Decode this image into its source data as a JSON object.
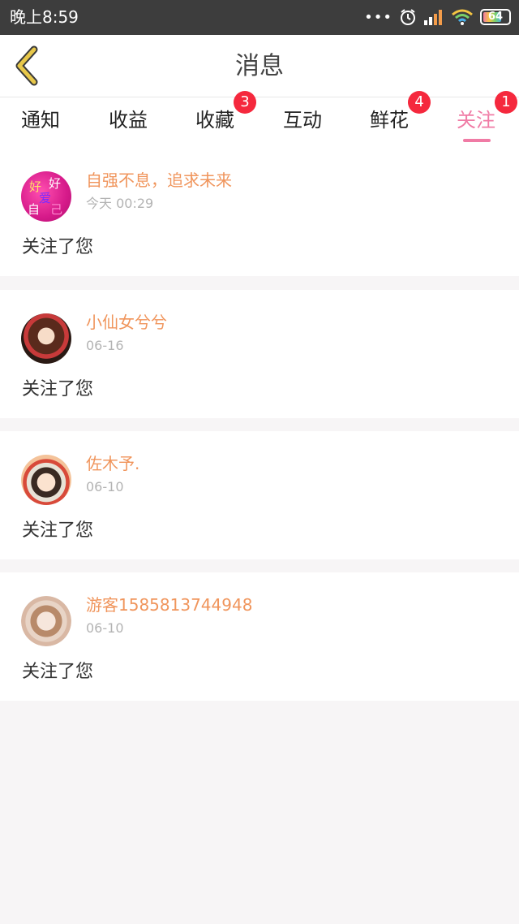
{
  "status_bar": {
    "time": "晚上8:59",
    "dots": "•••",
    "battery": "64"
  },
  "header": {
    "title": "消息"
  },
  "tabs": [
    {
      "label": "通知"
    },
    {
      "label": "收益"
    },
    {
      "label": "收藏",
      "badge": "3"
    },
    {
      "label": "互动"
    },
    {
      "label": "鲜花",
      "badge": "4"
    },
    {
      "label": "关注",
      "badge": "1",
      "active": true
    }
  ],
  "messages": [
    {
      "name": "自强不息，追求未来",
      "time": "今天 00:29",
      "text": "关注了您",
      "avatar_text": [
        "好",
        "好",
        "爱",
        "自",
        "己"
      ]
    },
    {
      "name": "小仙女兮兮",
      "time": "06-16",
      "text": "关注了您"
    },
    {
      "name": "佐木予.",
      "time": "06-10",
      "text": "关注了您"
    },
    {
      "name": "游客1585813744948",
      "time": "06-10",
      "text": "关注了您"
    }
  ],
  "colors": {
    "accent": "#f07ba5",
    "badge": "#f5283d",
    "name": "#f0955c",
    "back_icon": "#e8c84a"
  }
}
